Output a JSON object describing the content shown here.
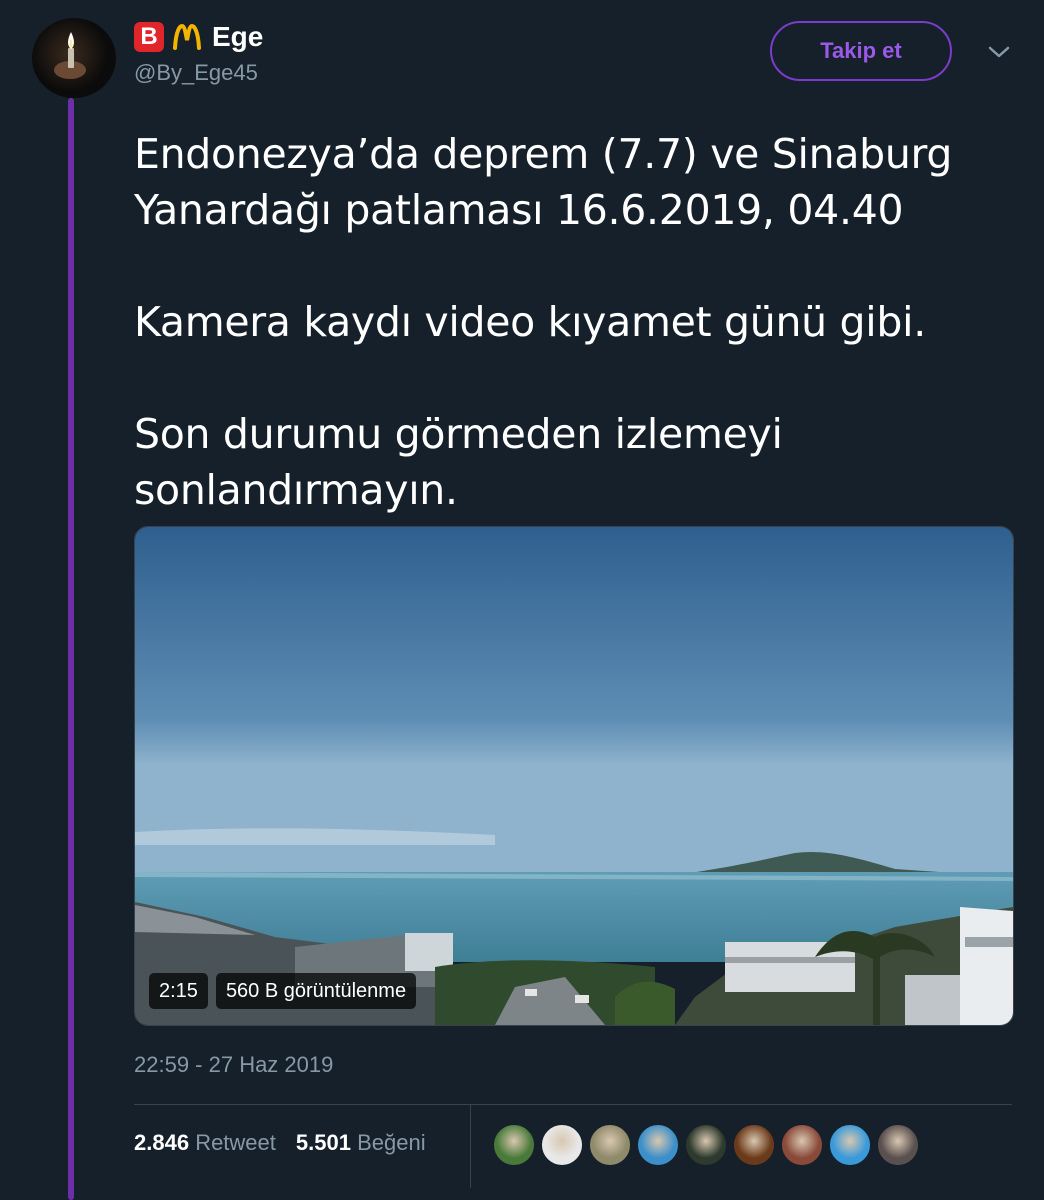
{
  "profile": {
    "badge_letter": "B",
    "display_name": "Ege",
    "handle": "@By_Ege45",
    "avatar_icon": "avatar-lighter-flame",
    "brand_colors": {
      "badge": "#e0252b",
      "m_logo": "#f5b400"
    }
  },
  "follow_button": {
    "label": "Takip et",
    "color": "#7b3cc9"
  },
  "tweet": {
    "paragraphs": [
      "Endonezya’da deprem (7.7) ve Sinaburg Yanardağı patlaması 16.6.2019, 04.40",
      "Kamera kaydı video kıyamet günü gibi.",
      "Son durumu görmeden izlemeyi sonlandırmayın."
    ]
  },
  "video": {
    "duration": "2:15",
    "views": "560 B görüntülenme"
  },
  "timestamp": "22:59 - 27 Haz 2019",
  "stats": {
    "retweet_count": "2.846",
    "retweet_label": "Retweet",
    "like_count": "5.501",
    "like_label": "Beğeni"
  },
  "likers": [
    {
      "name": "liker-avatar-flowers",
      "color": "#4a7a3a"
    },
    {
      "name": "liker-avatar-coffee",
      "color": "#e8e8e8"
    },
    {
      "name": "liker-avatar-drawing",
      "color": "#8f8a6a"
    },
    {
      "name": "liker-avatar-birds",
      "color": "#3d8fc9"
    },
    {
      "name": "liker-avatar-person-dark",
      "color": "#2d3a2d"
    },
    {
      "name": "liker-avatar-cowboy",
      "color": "#6b3a1a"
    },
    {
      "name": "liker-avatar-man",
      "color": "#8a4a3a"
    },
    {
      "name": "liker-avatar-beach",
      "color": "#3a9ad9"
    },
    {
      "name": "liker-avatar-woman",
      "color": "#5a5050"
    }
  ],
  "theme": {
    "background": "#15202b",
    "muted": "#8899a6",
    "thread_line": "#6d2fa8"
  }
}
